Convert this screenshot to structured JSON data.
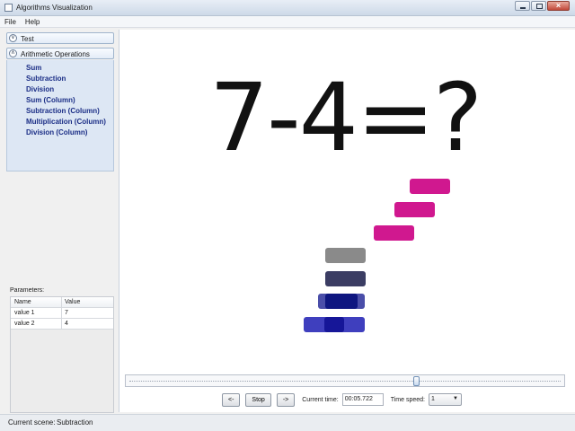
{
  "window": {
    "title": "Algorithms Visualization"
  },
  "menu": {
    "items": [
      "File",
      "Help"
    ]
  },
  "sidebar": {
    "groups": [
      {
        "label": "Test",
        "expanded": false
      },
      {
        "label": "Arithmetic Operations",
        "expanded": true
      }
    ],
    "operations": [
      "Sum",
      "Subtraction",
      "Division",
      "Sum (Column)",
      "Subtraction (Column)",
      "Multiplication (Column)",
      "Division (Column)"
    ]
  },
  "parameters": {
    "label": "Parameters:",
    "columns": [
      "Name",
      "Value"
    ],
    "rows": [
      {
        "name": "value 1",
        "value": "7"
      },
      {
        "name": "value 2",
        "value": "4"
      }
    ]
  },
  "scene": {
    "equation": "7-4=?",
    "colors": {
      "pink": "#d0188f",
      "gray": "#8a8a8a",
      "slate": "#3b3d63",
      "navy": "#141c8f",
      "blue": "#1f1fae"
    },
    "shown_blocks": {
      "pink": 3,
      "left_stack": 4
    }
  },
  "timeline": {
    "position_fraction": 0.665
  },
  "controls": {
    "back_label": "<-",
    "stop_label": "Stop",
    "forward_label": "->",
    "current_time_label": "Current time:",
    "current_time_value": "00:05.722",
    "speed_label": "Time speed:",
    "speed_value": "1"
  },
  "status": {
    "label": "Current scene:",
    "value": "Subtraction"
  }
}
